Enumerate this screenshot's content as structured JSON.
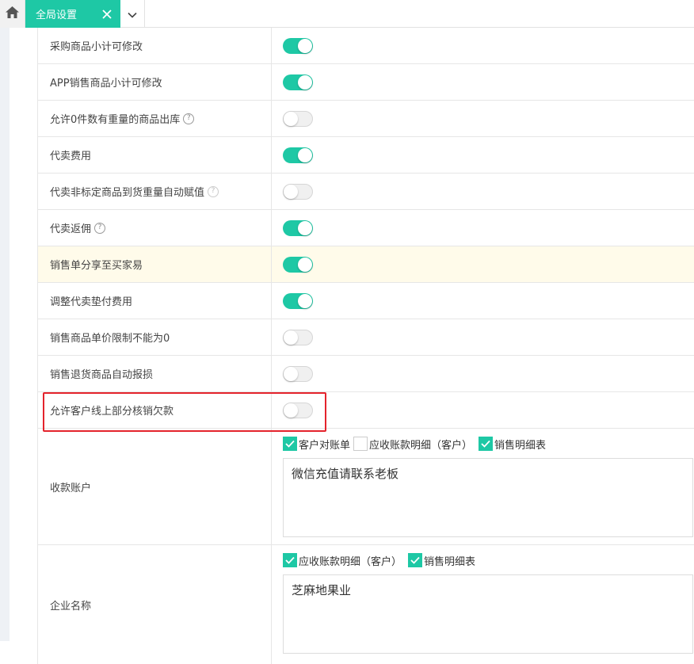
{
  "tabs": {
    "active_label": "全局设置",
    "close_symbol": "✕"
  },
  "colors": {
    "accent": "#1ec8a5",
    "highlight_row": "#fffbea",
    "annotation": "#e4232c"
  },
  "settings": [
    {
      "label": "采购商品小计可修改",
      "help": false,
      "enabled": true
    },
    {
      "label": "APP销售商品小计可修改",
      "help": false,
      "enabled": true
    },
    {
      "label": "允许0件数有重量的商品出库",
      "help": true,
      "enabled": false
    },
    {
      "label": "代卖费用",
      "help": false,
      "enabled": true
    },
    {
      "label": "代卖非标定商品到货重量自动赋值",
      "help": true,
      "enabled": false
    },
    {
      "label": "代卖返佣",
      "help": true,
      "enabled": true
    },
    {
      "label": "销售单分享至买家易",
      "help": false,
      "enabled": true,
      "highlighted": true
    },
    {
      "label": "调整代卖垫付费用",
      "help": false,
      "enabled": true
    },
    {
      "label": "销售商品单价限制不能为0",
      "help": false,
      "enabled": false
    },
    {
      "label": "销售退货商品自动报损",
      "help": false,
      "enabled": false
    },
    {
      "label": "允许客户线上部分核销欠款",
      "help": false,
      "enabled": false,
      "annotated": true
    }
  ],
  "help_symbol": "?",
  "receipt_account": {
    "label": "收款账户",
    "options": [
      {
        "label": "客户对账单",
        "checked": true
      },
      {
        "label": "应收账款明细（客户）",
        "checked": false
      },
      {
        "label": "销售明细表",
        "checked": true
      }
    ],
    "text": "微信充值请联系老板"
  },
  "company_name": {
    "label": "企业名称",
    "options": [
      {
        "label": "应收账款明细（客户）",
        "checked": true
      },
      {
        "label": "销售明细表",
        "checked": true
      }
    ],
    "text": "芝麻地果业"
  }
}
